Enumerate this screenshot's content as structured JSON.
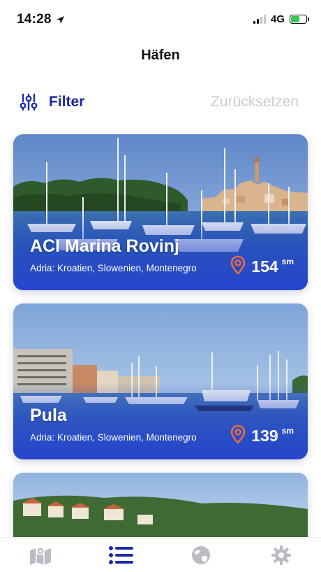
{
  "status_bar": {
    "time": "14:28",
    "network": "4G",
    "location_icon": "location-arrow-icon",
    "battery_color": "#34c759"
  },
  "header": {
    "title": "Häfen"
  },
  "filter_bar": {
    "filter_label": "Filter",
    "filter_icon": "sliders-icon",
    "reset_label": "Zurücksetzen"
  },
  "harbors": [
    {
      "name": "ACI Marina Rovinj",
      "region": "Adria: Kroatien, Slowenien, Montenegro",
      "distance": "154",
      "unit": "sm"
    },
    {
      "name": "Pula",
      "region": "Adria: Kroatien, Slowenien, Montenegro",
      "distance": "139",
      "unit": "sm"
    }
  ],
  "tab_bar": {
    "tabs": [
      {
        "icon": "map-icon",
        "active": false
      },
      {
        "icon": "list-icon",
        "active": true
      },
      {
        "icon": "globe-icon",
        "active": false
      },
      {
        "icon": "gear-icon",
        "active": false
      }
    ]
  },
  "colors": {
    "accent": "#1b2aa8",
    "pin": "#f06a3c",
    "inactive_tab": "#b9bcc4",
    "reset_text": "#c9ccd4"
  }
}
